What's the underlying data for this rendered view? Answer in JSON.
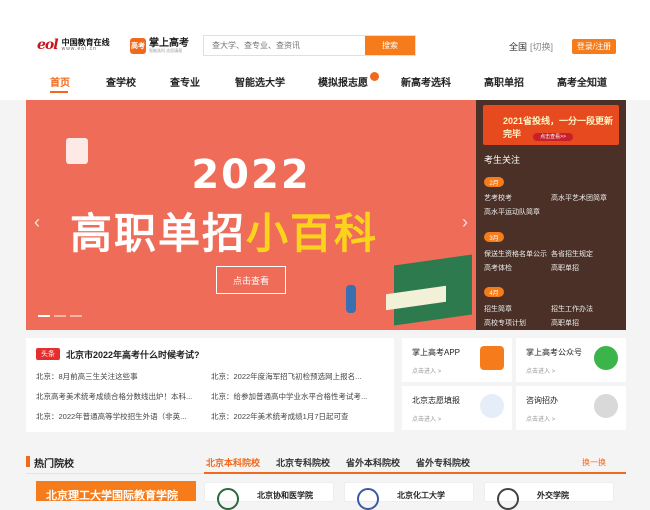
{
  "header": {
    "logo_main": "eol",
    "logo_cn": "中国教育在线",
    "logo_url": "www.eol.cn",
    "brand_badge": "高考",
    "brand_name": "掌上高考",
    "brand_sub": "智能选科 志愿填报",
    "search_placeholder": "查大学、查专业、查资讯",
    "search_button": "搜索",
    "region": "全国",
    "region_switch": "[切换]",
    "login": "登录/注册"
  },
  "nav": [
    {
      "label": "首页"
    },
    {
      "label": "查学校"
    },
    {
      "label": "查专业"
    },
    {
      "label": "智能选大学"
    },
    {
      "label": "模拟报志愿"
    },
    {
      "label": "新高考选科"
    },
    {
      "label": "高职单招"
    },
    {
      "label": "高考全知道"
    }
  ],
  "banner": {
    "year": "2022",
    "title_white": "高职单招",
    "title_yellow": "小百科",
    "button": "点击查看"
  },
  "side": {
    "promo": "2021省投线，一分一段更新完毕",
    "promo_btn": "点击查看>>",
    "heading": "考生关注",
    "groups": [
      {
        "month": "2月",
        "items": [
          "艺考校考",
          "高水平艺术团简章",
          "高水平运动队简章"
        ]
      },
      {
        "month": "3月",
        "items": [
          "保送生资格名单公示",
          "各省招生规定",
          "高考体检",
          "高职单招"
        ]
      },
      {
        "month": "4月",
        "items": [
          "招生简章",
          "招生工作办法",
          "高校专项计划",
          "高职单招"
        ]
      }
    ]
  },
  "news": {
    "badge": "头条",
    "title": "北京市2022年高考什么时候考试?",
    "items": [
      "北京：8月前高三生关注这些事",
      "北京：2022年度海军招飞初检预选网上报名...",
      "北京高考美术统考成绩合格分数线出炉！本科...",
      "北京：给参加普通高中学业水平合格性考试考...",
      "北京：2022年普通高等学校招生外语（非英...",
      "北京：2022年美术统考成绩1月7日起可查"
    ]
  },
  "services": [
    {
      "name": "掌上高考APP",
      "enter": "点击进入 >"
    },
    {
      "name": "掌上高考公众号",
      "enter": "点击进入 >"
    },
    {
      "name": "北京志愿填报",
      "enter": "点击进入 >"
    },
    {
      "name": "咨询招办",
      "enter": "点击进入 >"
    }
  ],
  "hot": {
    "title": "热门院校",
    "tabs": [
      "北京本科院校",
      "北京专科院校",
      "省外本科院校",
      "省外专科院校"
    ],
    "refresh": "换一换",
    "featured": "北京理工大学国际教育学院",
    "unis": [
      "北京协和医学院",
      "北京化工大学",
      "外交学院"
    ]
  },
  "colors": {
    "accent": "#f67c1b",
    "banner": "#ee6c58",
    "side": "#4a3026"
  }
}
